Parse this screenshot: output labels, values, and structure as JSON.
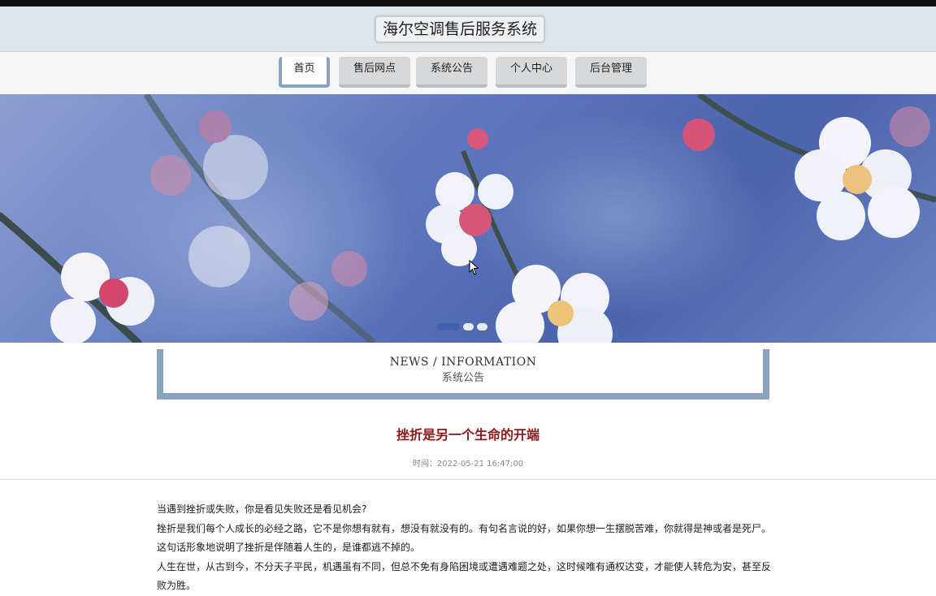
{
  "header": {
    "title": "海尔空调售后服务系统"
  },
  "nav": {
    "items": [
      {
        "label": "首页"
      },
      {
        "label": "售后网点"
      },
      {
        "label": "系统公告"
      },
      {
        "label": "个人中心"
      },
      {
        "label": "后台管理"
      }
    ]
  },
  "carousel": {
    "slide_count": 3,
    "active_index": 0
  },
  "notice": {
    "english": "NEWS / INFORMATION",
    "chinese": "系统公告"
  },
  "article": {
    "title": "挫折是另一个生命的开端",
    "time": "时间：2022-05-21 16:47:00",
    "paragraphs": [
      "当遇到挫折或失败，你是看见失败还是看见机会?",
      "挫折是我们每个人成长的必经之路，它不是你想有就有，想没有就没有的。有句名言说的好，如果你想一生摆脱苦难，你就得是神或者是死尸。这句话形象地说明了挫折是伴随着人生的，是谁都逃不掉的。",
      "人生在世，从古到今，不分天子平民，机遇虽有不同，但总不免有身陷困境或遭遇难题之处，这时候唯有通权达变，才能使人转危为安，甚至反败为胜。"
    ]
  },
  "colors": {
    "accent": "#8aa2c0",
    "title_red": "#8b1a1a",
    "header_bg": "#dde4ea"
  }
}
